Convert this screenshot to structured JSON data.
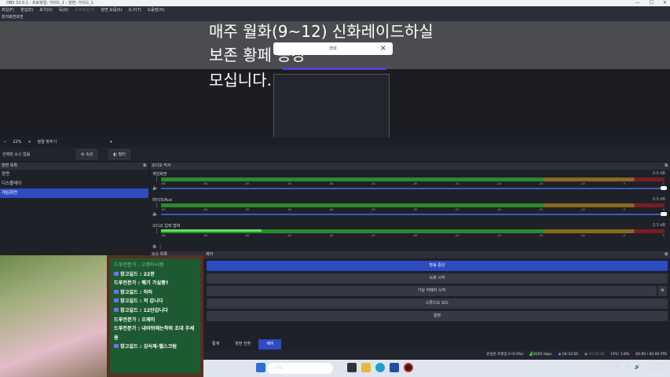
{
  "window": {
    "title": "OBS 32.0.1 - 프로파일: 가이드_1 - 장면: 가이드_1"
  },
  "menu": [
    "파일(F)",
    "편집(E)",
    "보기(V)",
    "독(D)",
    "프로파일(P)",
    "장면 모음(S)",
    "도구(T)",
    "도움말(H)"
  ],
  "preview": {
    "header": "최저화면보면",
    "overlay_lines": [
      "매주 월화(9~12) 신화레이드하실",
      "보존 황페 증강",
      "모십니다."
    ],
    "popup_title": "안내"
  },
  "zoombar": {
    "minus": "−",
    "zoom": "22%",
    "plus": "+",
    "align": "정렬 맞추기",
    "caret": "▾"
  },
  "sourcebar": {
    "none": "선택된 소스 없음",
    "properties": "⚙ 속성",
    "filters": "◧ 필터"
  },
  "scenes": {
    "title": "장면 목록",
    "items": [
      "장면",
      "디스플레이",
      "게임화면"
    ],
    "selected": 2
  },
  "mixer": {
    "title": "오디오 믹서",
    "ticks": [
      "-60",
      "-55",
      "-50",
      "-45",
      "-40",
      "-35",
      "-30",
      "-25",
      "-20",
      "-15",
      "-10",
      "-5",
      "0"
    ],
    "channels": [
      {
        "name": "게임화면",
        "db": "0.0 dB",
        "level": 1.0
      },
      {
        "name": "마이크/Aux",
        "db": "0.0 dB",
        "level": 1.0
      },
      {
        "name": "오디오 입력 캡쳐",
        "db": "-3.3 dB",
        "level": 0.2
      }
    ]
  },
  "sources": {
    "title": "소스 목록"
  },
  "controls": {
    "title": "제어",
    "buttons": [
      "방송 중단",
      "녹화 시작",
      "가상 카메라 시작",
      "스튜디오 모드",
      "설정"
    ]
  },
  "tabs": [
    "통계",
    "장면 전환",
    "제어"
  ],
  "status": {
    "dropped": "손실된 프레임 0 (0.0%)",
    "bitrate": "8205 kbps",
    "live": "04:33:50",
    "rec": "00:00:00",
    "cpu": "CPU: 1.8%",
    "fps": "60.00 / 60.00 FPS"
  },
  "chat": [
    {
      "user": "드루전문가",
      "msg": "고생하시셈",
      "badge": false,
      "dim": true
    },
    {
      "user": "창고길드",
      "msg": "22분",
      "badge": true
    },
    {
      "user": "드루전문가",
      "msg": "뭬기 가실뿅?",
      "badge": false
    },
    {
      "user": "창고길드",
      "msg": "허허",
      "badge": true
    },
    {
      "user": "창고길드",
      "msg": "저 갑니다",
      "badge": true
    },
    {
      "user": "창고길드",
      "msg": "12단갑니다",
      "badge": true
    },
    {
      "user": "드루전문가",
      "msg": "오께이",
      "badge": false
    },
    {
      "user": "드루전문가",
      "msg": "내비뒤에는착혀 초대 주세용",
      "badge": false
    },
    {
      "user": "창고길드",
      "msg": "김식제-헬스크림",
      "badge": true
    }
  ],
  "taskbar": {
    "search": "검색",
    "time": "오전 12:06",
    "date": "2025-11-07",
    "lang": "A"
  }
}
